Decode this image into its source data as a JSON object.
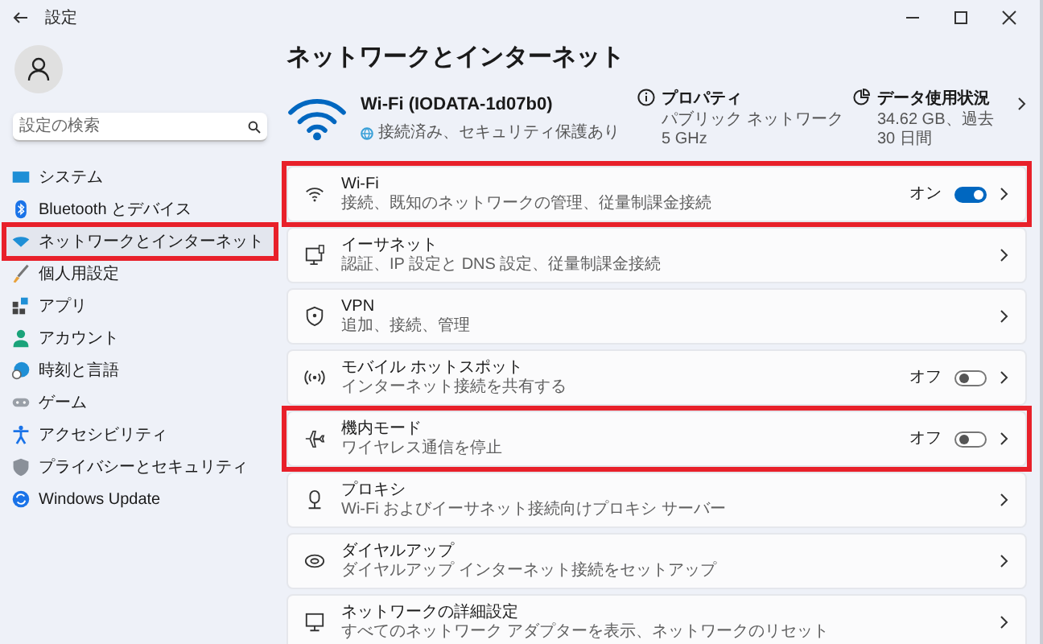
{
  "window": {
    "title": "設定"
  },
  "search": {
    "placeholder": "設定の検索"
  },
  "sidebar": {
    "items": [
      {
        "label": "システム",
        "selected": false,
        "highlighted": false
      },
      {
        "label": "Bluetooth とデバイス",
        "selected": false,
        "highlighted": false
      },
      {
        "label": "ネットワークとインターネット",
        "selected": true,
        "highlighted": true
      },
      {
        "label": "個人用設定",
        "selected": false,
        "highlighted": false
      },
      {
        "label": "アプリ",
        "selected": false,
        "highlighted": false
      },
      {
        "label": "アカウント",
        "selected": false,
        "highlighted": false
      },
      {
        "label": "時刻と言語",
        "selected": false,
        "highlighted": false
      },
      {
        "label": "ゲーム",
        "selected": false,
        "highlighted": false
      },
      {
        "label": "アクセシビリティ",
        "selected": false,
        "highlighted": false
      },
      {
        "label": "プライバシーとセキュリティ",
        "selected": false,
        "highlighted": false
      },
      {
        "label": "Windows Update",
        "selected": false,
        "highlighted": false
      }
    ]
  },
  "page_title": "ネットワークとインターネット",
  "summary": {
    "name": "Wi-Fi (IODATA-1d07b0)",
    "status": "接続済み、セキュリティ保護あり",
    "properties": {
      "title": "プロパティ",
      "lines": [
        "パブリック ネットワーク",
        "5 GHz"
      ]
    },
    "data_usage": {
      "title": "データ使用状況",
      "detail": "34.62 GB、過去 30 日間"
    }
  },
  "settings": [
    {
      "kind": "toggle",
      "title": "Wi-Fi",
      "description": "接続、既知のネットワークの管理、従量制課金接続",
      "toggle_label": "オン",
      "on": true,
      "highlighted": true
    },
    {
      "kind": "link",
      "title": "イーサネット",
      "description": "認証、IP 設定と DNS 設定、従量制課金接続",
      "highlighted": false
    },
    {
      "kind": "link",
      "title": "VPN",
      "description": "追加、接続、管理",
      "highlighted": false
    },
    {
      "kind": "toggle",
      "title": "モバイル ホットスポット",
      "description": "インターネット接続を共有する",
      "toggle_label": "オフ",
      "on": false,
      "highlighted": false
    },
    {
      "kind": "toggle",
      "title": "機内モード",
      "description": "ワイヤレス通信を停止",
      "toggle_label": "オフ",
      "on": false,
      "highlighted": true
    },
    {
      "kind": "link",
      "title": "プロキシ",
      "description": "Wi-Fi およびイーサネット接続向けプロキシ サーバー",
      "highlighted": false
    },
    {
      "kind": "link",
      "title": "ダイヤルアップ",
      "description": "ダイヤルアップ インターネット接続をセットアップ",
      "highlighted": false
    },
    {
      "kind": "link",
      "title": "ネットワークの詳細設定",
      "description": "すべてのネットワーク アダプターを表示、ネットワークのリセット",
      "highlighted": false
    }
  ]
}
